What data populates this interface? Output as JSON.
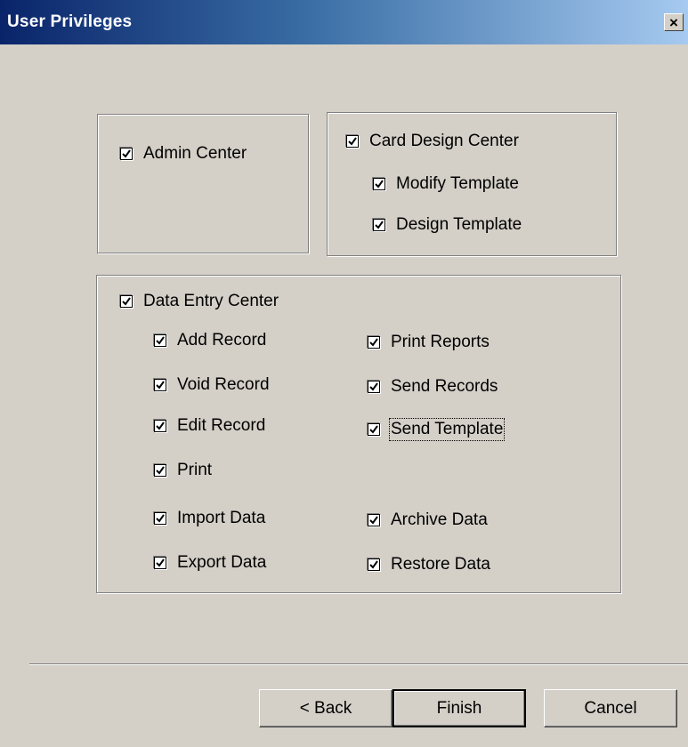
{
  "window": {
    "title": "User Privileges",
    "close_glyph": "×"
  },
  "admin_group": {
    "admin_center": {
      "label": "Admin Center",
      "checked": true
    }
  },
  "card_design_group": {
    "card_design_center": {
      "label": "Card Design Center",
      "checked": true
    },
    "modify_template": {
      "label": "Modify Template",
      "checked": true
    },
    "design_template": {
      "label": "Design Template",
      "checked": true
    }
  },
  "data_entry_group": {
    "data_entry_center": {
      "label": "Data Entry Center",
      "checked": true
    },
    "left_column": [
      {
        "label": "Add Record",
        "checked": true
      },
      {
        "label": "Void Record",
        "checked": true
      },
      {
        "label": "Edit Record",
        "checked": true
      },
      {
        "label": "Print",
        "checked": true
      },
      {
        "label": "Import Data",
        "checked": true
      },
      {
        "label": "Export Data",
        "checked": true
      }
    ],
    "right_column": [
      {
        "label": "Print Reports",
        "checked": true
      },
      {
        "label": "Send Records",
        "checked": true
      },
      {
        "label": "Send Template",
        "checked": true,
        "focused": true
      },
      {
        "label": "Archive Data",
        "checked": true
      },
      {
        "label": "Restore Data",
        "checked": true
      }
    ]
  },
  "buttons": {
    "back": "< Back",
    "finish": "Finish",
    "cancel": "Cancel"
  }
}
